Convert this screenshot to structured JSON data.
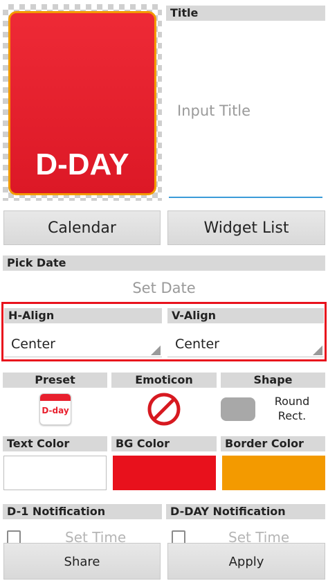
{
  "widget_preview": {
    "text": "D-DAY",
    "bg_color": "#e8202e",
    "border_color": "#f39a00"
  },
  "title": {
    "header": "Title",
    "placeholder": "Input Title"
  },
  "buttons": {
    "calendar": "Calendar",
    "widget_list": "Widget List",
    "share": "Share",
    "apply": "Apply"
  },
  "pick_date": {
    "header": "Pick Date",
    "value": "Set Date"
  },
  "h_align": {
    "header": "H-Align",
    "value": "Center"
  },
  "v_align": {
    "header": "V-Align",
    "value": "Center"
  },
  "preset": {
    "header": "Preset",
    "icon_text": "D-day"
  },
  "emoticon": {
    "header": "Emoticon"
  },
  "shape": {
    "header": "Shape",
    "value_line1": "Round",
    "value_line2": "Rect."
  },
  "colors": {
    "text_header": "Text Color",
    "text_value": "#ffffff",
    "bg_header": "BG Color",
    "bg_value": "#e8111c",
    "border_header": "Border Color",
    "border_value": "#f39a00"
  },
  "notifications": {
    "d1_header": "D-1 Notification",
    "d1_time": "Set Time",
    "dday_header": "D-DAY Notification",
    "dday_time": "Set Time"
  },
  "highlight_color": "#e8111c"
}
